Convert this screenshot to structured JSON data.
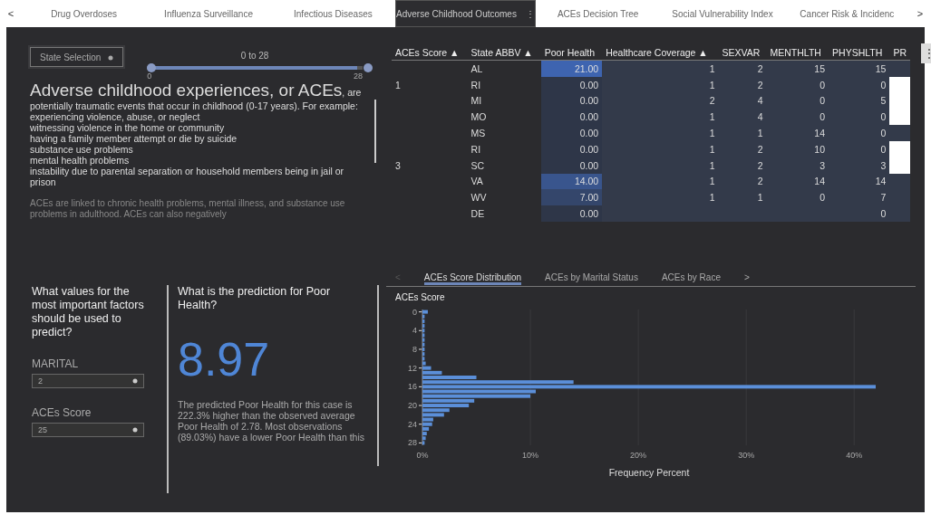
{
  "tab_bar": {
    "prev": "<",
    "next": ">",
    "tabs": [
      {
        "label": "Drug Overdoses",
        "selected": false
      },
      {
        "label": "Influenza Surveillance",
        "selected": false
      },
      {
        "label": "Infectious Diseases",
        "selected": false
      },
      {
        "label": "Adverse Childhood Outcomes",
        "selected": true,
        "menu": "⋮"
      },
      {
        "label": "ACEs Decision Tree",
        "selected": false
      },
      {
        "label": "Social Vulnerability Index",
        "selected": false
      },
      {
        "label": "Cancer Risk & Incidenc",
        "selected": false
      }
    ]
  },
  "filter": {
    "dropdown": "State Selection",
    "range": {
      "label": "0 to 28",
      "min": "0",
      "max": "28",
      "level": 1
    }
  },
  "intro": {
    "heading": "Adverse childhood experiences, or ACEs",
    "heading_tail": ", are",
    "text": "potentially traumatic events that occur in childhood (0-17 years). For example:",
    "items": [
      "experiencing violence, abuse, or neglect",
      "witnessing violence in the home or community",
      "having a family member attempt or die by suicide",
      "substance use problems",
      "mental health problems",
      "instability due to parental separation or household members being in jail or prison"
    ],
    "footer": "ACEs are linked to chronic health problems, mental illness, and substance use problems in adulthood. ACEs can also negatively"
  },
  "table": {
    "columns": [
      "ACEs Score ▲",
      "State ABBV ▲",
      "Poor Health",
      "Healthcare Coverage ▲",
      "SEXVAR",
      "MENTHLTH",
      "PHYSHLTH",
      "PR"
    ],
    "menu": "⋮",
    "rows": [
      {
        "cells": [
          "",
          "AL",
          "21.00",
          "1",
          "2",
          "15",
          "15"
        ],
        "flag": false
      },
      {
        "cells": [
          "1",
          "RI",
          "0.00",
          "1",
          "2",
          "0",
          "0"
        ],
        "flag": true
      },
      {
        "cells": [
          "",
          "MI",
          "0.00",
          "2",
          "4",
          "0",
          "5"
        ],
        "flag": true
      },
      {
        "cells": [
          "",
          "MO",
          "0.00",
          "1",
          "4",
          "0",
          "0"
        ],
        "flag": true
      },
      {
        "cells": [
          "",
          "MS",
          "0.00",
          "1",
          "1",
          "14",
          "0"
        ],
        "flag": false
      },
      {
        "cells": [
          "",
          "RI",
          "0.00",
          "1",
          "2",
          "10",
          "0"
        ],
        "flag": true
      },
      {
        "cells": [
          "3",
          "SC",
          "0.00",
          "1",
          "2",
          "3",
          "3"
        ],
        "flag": true
      },
      {
        "cells": [
          "",
          "VA",
          "14.00",
          "1",
          "2",
          "14",
          "14"
        ],
        "flag": false
      },
      {
        "cells": [
          "",
          "WV",
          "7.00",
          "1",
          "1",
          "0",
          "7"
        ],
        "flag": false
      },
      {
        "cells": [
          "",
          "DE",
          "0.00",
          null,
          null,
          null,
          "0"
        ],
        "flag": false
      }
    ]
  },
  "predictors": {
    "question": "What values for the most important factors should be used to predict?",
    "fields": [
      {
        "label": "MARITAL",
        "value": "2"
      },
      {
        "label": "ACEs Score",
        "value": "25"
      }
    ]
  },
  "prediction": {
    "question": "What is the prediction for Poor Health?",
    "value": "8.97",
    "text": "The predicted Poor Health for this case is 222.3% higher than the observed average Poor Health of 2.78. Most observations (89.03%) have a lower Poor Health than this"
  },
  "chart_tabs": {
    "prev": "<",
    "next": ">",
    "tabs": [
      {
        "label": "ACEs Score Distribution",
        "selected": true
      },
      {
        "label": "ACEs by Marital Status",
        "selected": false
      },
      {
        "label": "ACEs by Race",
        "selected": false
      }
    ]
  },
  "chart_data": {
    "type": "bar",
    "orientation": "horizontal",
    "ylabel": "ACEs Score",
    "xlabel": "Frequency Percent",
    "x": [
      0,
      1,
      2,
      3,
      4,
      5,
      6,
      7,
      8,
      9,
      10,
      11,
      12,
      13,
      14,
      15,
      16,
      17,
      18,
      19,
      20,
      21,
      22,
      23,
      24,
      25,
      26,
      27,
      28
    ],
    "grid": true,
    "series": [
      {
        "color": "#5b8fd9",
        "values": [
          0.5,
          0.2,
          0.2,
          0.2,
          0.2,
          0.2,
          0.2,
          0.2,
          0.2,
          0.2,
          0.2,
          0.3,
          0.8,
          1.8,
          5,
          14,
          42,
          10.5,
          10,
          4.8,
          4.3,
          2.5,
          2,
          1,
          0.9,
          0.6,
          0.4,
          0.3,
          0.2
        ]
      }
    ],
    "xlim": [
      0,
      42
    ],
    "xticks": [
      {
        "value": 0,
        "label": "0%"
      },
      {
        "value": 10,
        "label": "10%"
      },
      {
        "value": 20,
        "label": "20%"
      },
      {
        "value": 30,
        "label": "30%"
      },
      {
        "value": 40,
        "label": "40%"
      }
    ],
    "ylim": [
      28.5,
      -0.5
    ],
    "yticks": [
      0,
      4,
      8,
      12,
      16,
      20,
      24,
      28
    ]
  }
}
